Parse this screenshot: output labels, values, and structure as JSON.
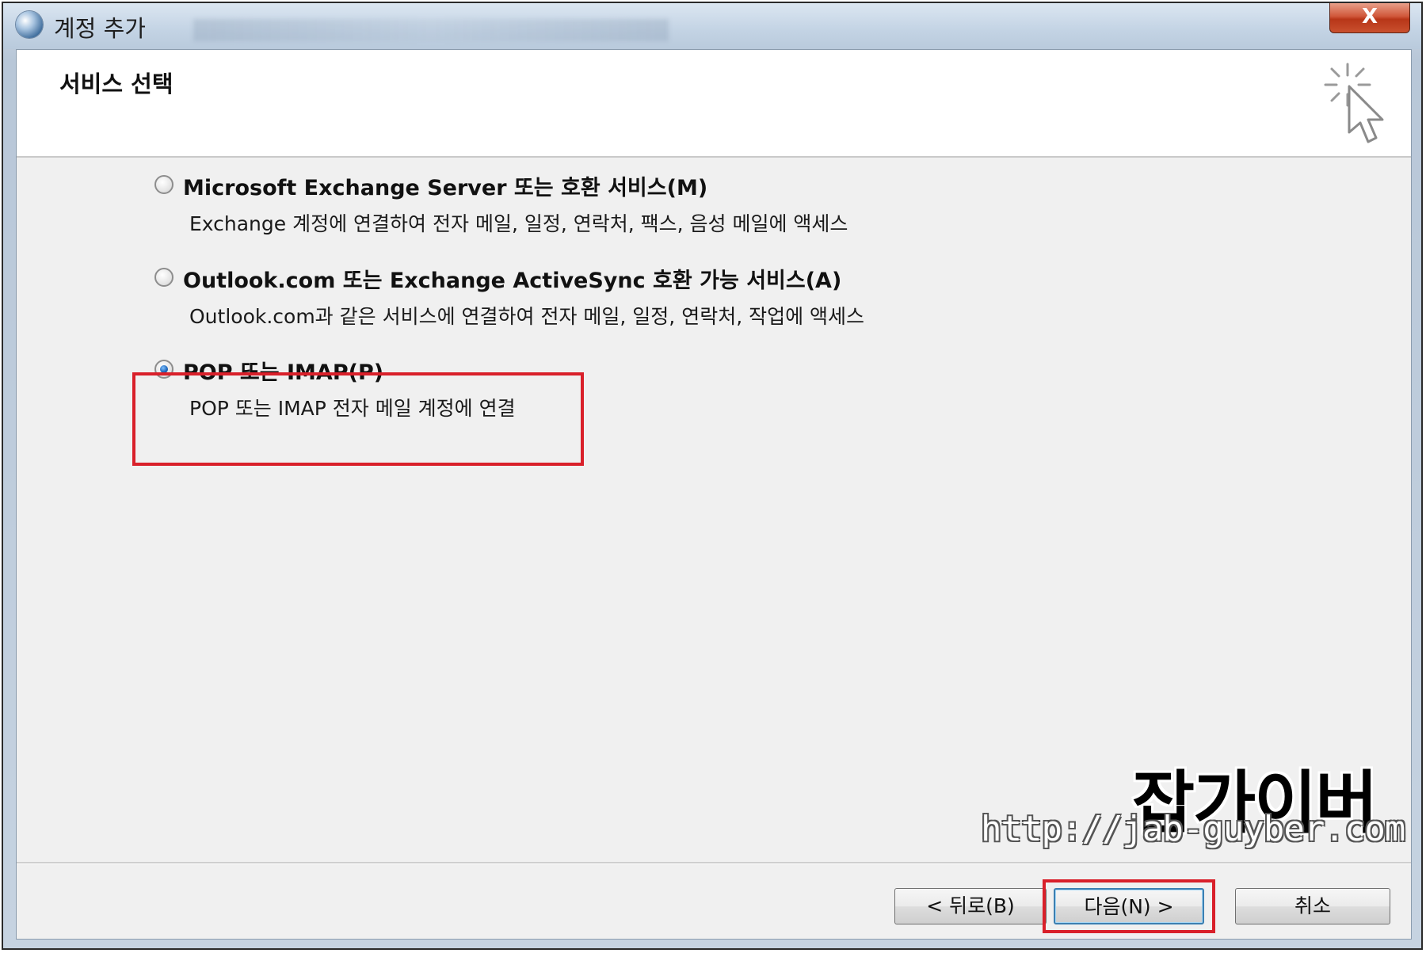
{
  "window": {
    "title": "계정 추가",
    "close_label": "X"
  },
  "header": {
    "title": "서비스 선택",
    "icon": "wizard-sparkle-cursor-icon"
  },
  "options": [
    {
      "label": "Microsoft Exchange Server 또는 호환 서비스(M)",
      "description": "Exchange 계정에 연결하여 전자 메일, 일정, 연락처, 팩스, 음성 메일에 액세스",
      "selected": false
    },
    {
      "label": "Outlook.com 또는 Exchange ActiveSync 호환 가능 서비스(A)",
      "description": "Outlook.com과 같은 서비스에 연결하여 전자 메일, 일정, 연락처, 작업에 액세스",
      "selected": false
    },
    {
      "label": "POP 또는 IMAP(P)",
      "description": "POP 또는 IMAP 전자 메일 계정에 연결",
      "selected": true
    }
  ],
  "buttons": {
    "back": "< 뒤로(B)",
    "next": "다음(N) >",
    "cancel": "취소"
  },
  "watermark": {
    "title": "잡가이버",
    "url": "http://jab-guyber.com"
  },
  "colors": {
    "highlight": "#d9202a",
    "client_bg": "#f0f0f0"
  }
}
